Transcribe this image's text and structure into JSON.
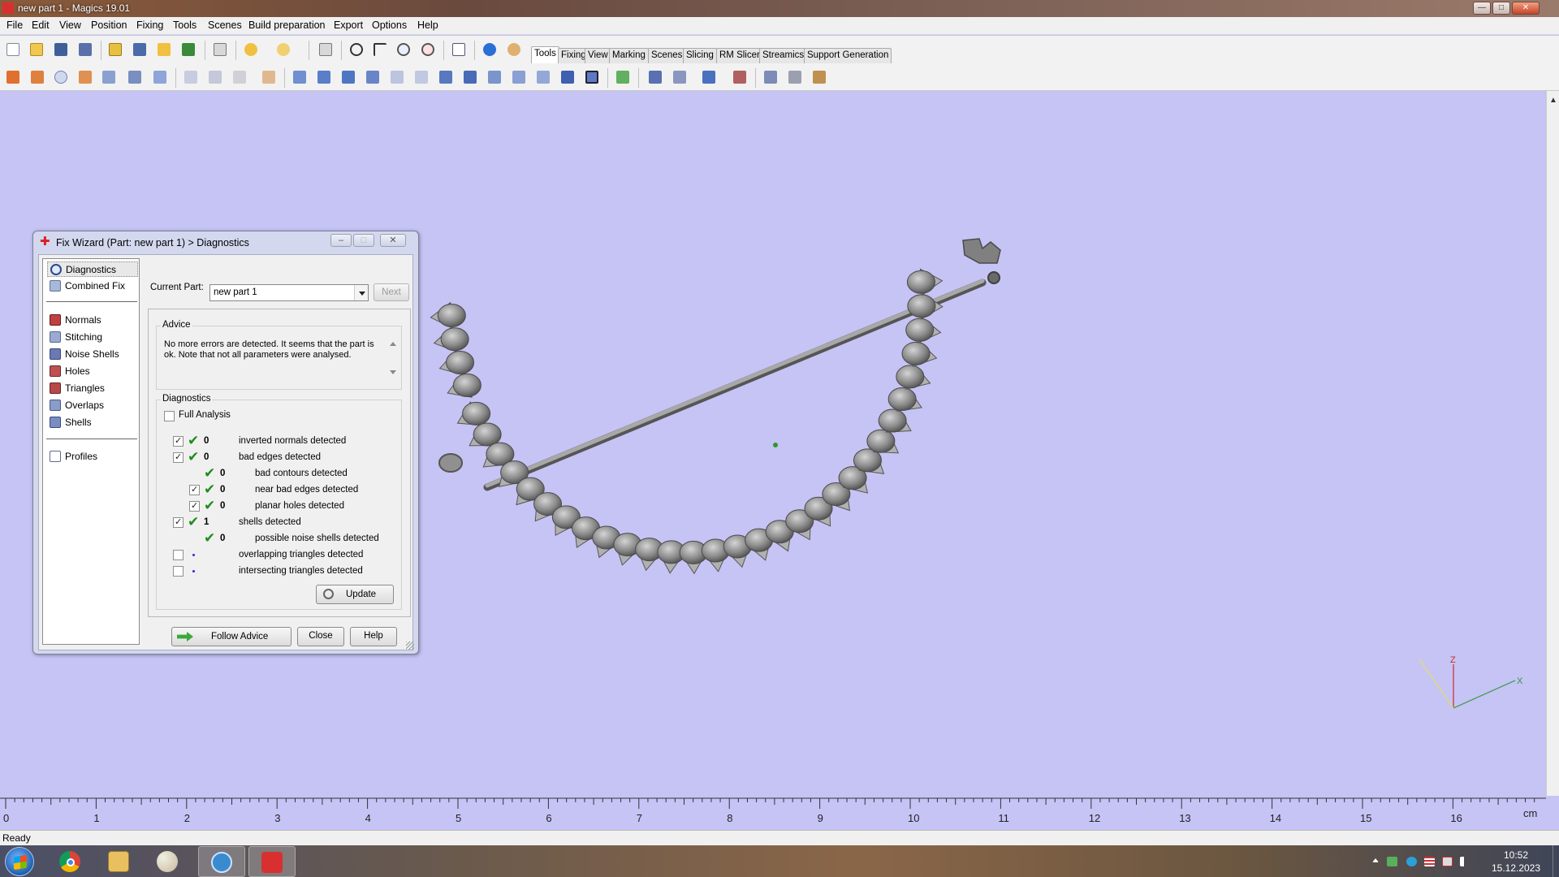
{
  "window": {
    "title": "new part 1 - Magics 19.01",
    "controls": [
      "minimize",
      "maximize",
      "close"
    ]
  },
  "menu": [
    "File",
    "Edit",
    "View",
    "Position",
    "Fixing",
    "Tools",
    "Scenes",
    "Build preparation",
    "Export",
    "Options",
    "Help"
  ],
  "toolbar_tabs": {
    "items": [
      "Tools",
      "Fixing",
      "View",
      "Marking",
      "Scenes",
      "Slicing",
      "RM Slicer",
      "Streamics",
      "Support Generation"
    ],
    "active": "Tools"
  },
  "ruler": {
    "unit": "cm",
    "labels": [
      "0",
      "1",
      "2",
      "3",
      "4",
      "5",
      "6",
      "7",
      "8",
      "9",
      "10",
      "11",
      "12",
      "13",
      "14",
      "15",
      "16"
    ]
  },
  "status": {
    "text": "Ready"
  },
  "axes": {
    "z": "Z",
    "x": "X"
  },
  "fix_wizard": {
    "title": "Fix Wizard (Part: new part 1) > Diagnostics",
    "nav": [
      {
        "label": "Diagnostics",
        "icon": "magnifier-icon",
        "selected": true
      },
      {
        "label": "Combined Fix",
        "icon": "cube-icon"
      },
      {
        "label": "Normals",
        "icon": "normals-icon"
      },
      {
        "label": "Stitching",
        "icon": "stitching-icon"
      },
      {
        "label": "Noise Shells",
        "icon": "noise-shells-icon"
      },
      {
        "label": "Holes",
        "icon": "holes-icon"
      },
      {
        "label": "Triangles",
        "icon": "triangles-icon"
      },
      {
        "label": "Overlaps",
        "icon": "overlaps-icon"
      },
      {
        "label": "Shells",
        "icon": "shells-icon"
      },
      {
        "label": "Profiles",
        "icon": "profiles-icon"
      }
    ],
    "current_part_label": "Current Part:",
    "current_part_value": "new part 1",
    "next_label": "Next",
    "advice_title": "Advice",
    "advice_text": "No more errors are detected. It seems that the part is ok. Note that not all parameters were analysed.",
    "diagnostics_title": "Diagnostics",
    "full_analysis_label": "Full Analysis",
    "rows": [
      {
        "checked": true,
        "status": "ok",
        "count": "0",
        "label": "inverted normals detected"
      },
      {
        "checked": true,
        "status": "ok",
        "count": "0",
        "label": "bad edges detected"
      },
      {
        "checked": null,
        "status": "ok",
        "count": "0",
        "label": "bad contours detected"
      },
      {
        "checked": true,
        "status": "ok",
        "count": "0",
        "label": "near bad edges detected"
      },
      {
        "checked": true,
        "status": "ok",
        "count": "0",
        "label": "planar holes detected"
      },
      {
        "checked": true,
        "status": "ok",
        "count": "1",
        "label": "shells detected"
      },
      {
        "checked": null,
        "status": "ok",
        "count": "0",
        "label": "possible noise shells detected"
      },
      {
        "checked": false,
        "status": "pending",
        "count": "",
        "label": "overlapping triangles detected"
      },
      {
        "checked": false,
        "status": "pending",
        "count": "",
        "label": "intersecting triangles detected"
      }
    ],
    "update_label": "Update",
    "follow_advice_label": "Follow Advice",
    "close_label": "Close",
    "help_label": "Help"
  },
  "taskbar": {
    "apps": [
      "chrome",
      "file-explorer",
      "paint",
      "browser",
      "magics"
    ],
    "active_app": "magics",
    "time": "10:52",
    "date": "15.12.2023"
  },
  "colors": {
    "viewport": "#c6c3f5",
    "model": "#8a8a8a",
    "check_green": "#1e8c1e"
  }
}
